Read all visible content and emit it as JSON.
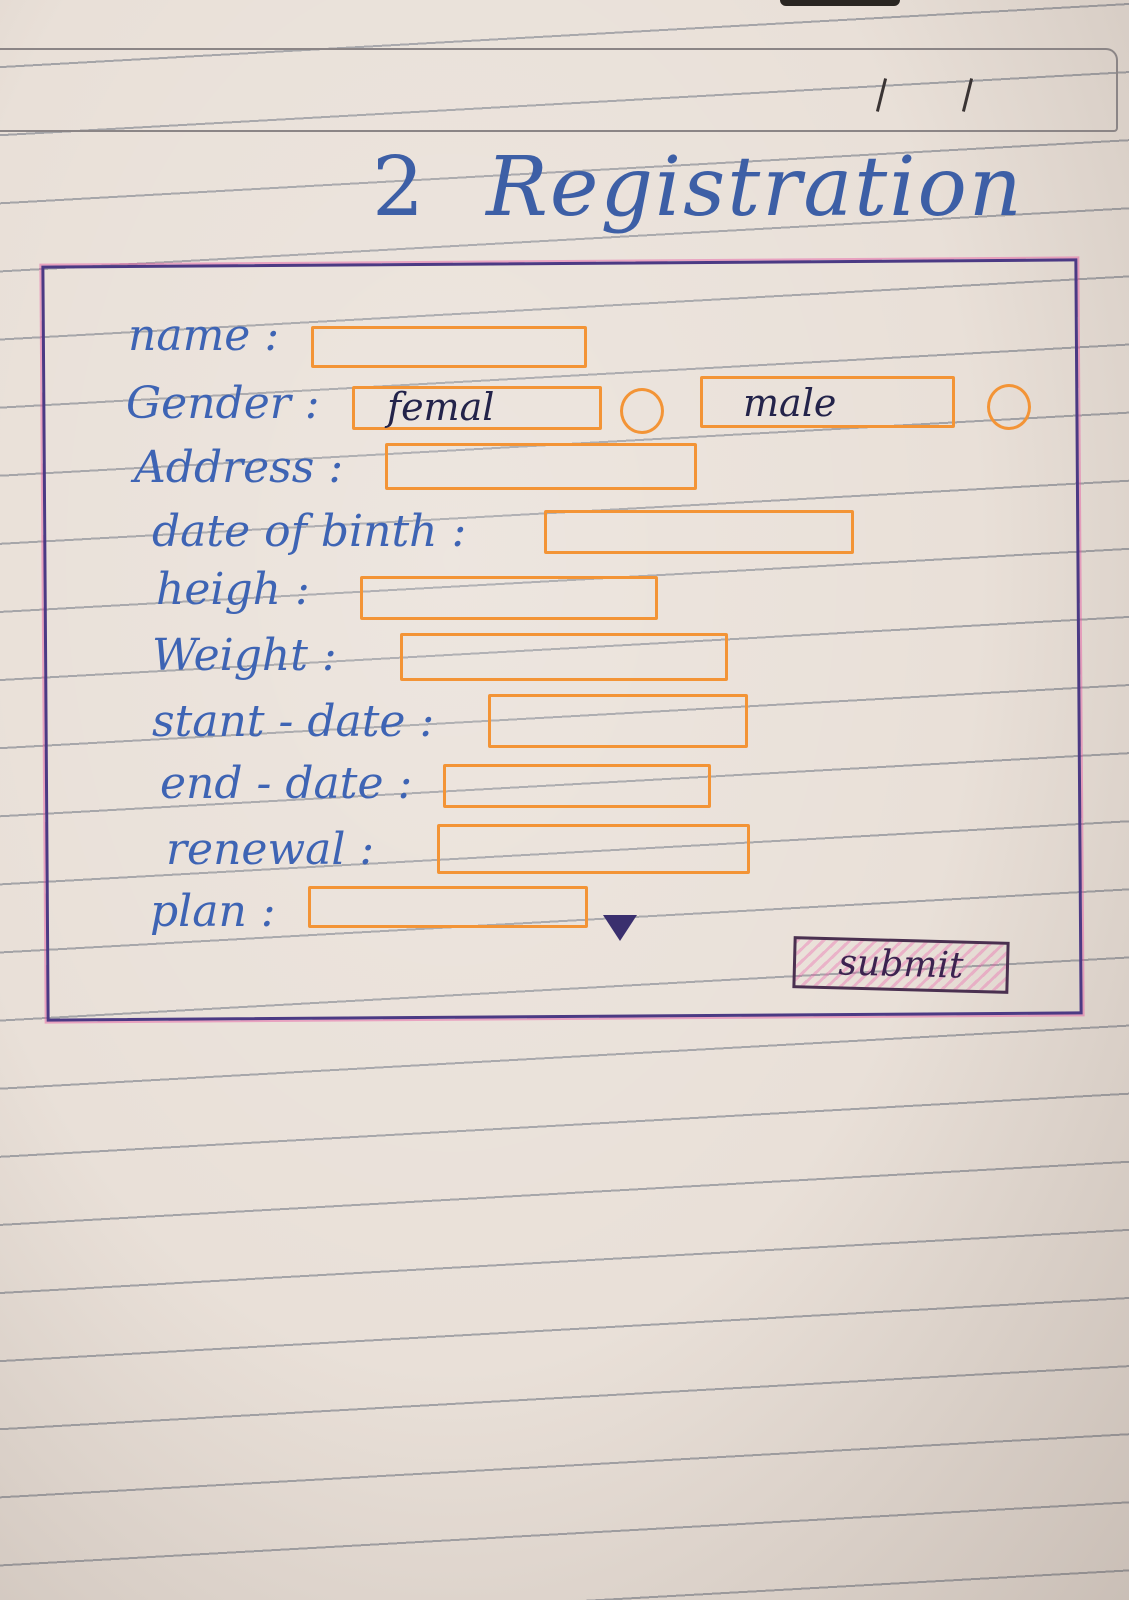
{
  "header": {
    "date_slashes": "/ /"
  },
  "title": {
    "number": "2",
    "text": "Registration"
  },
  "form": {
    "name_label": "name :",
    "gender_label": "Gender :",
    "gender_female": "femal",
    "gender_male": "male",
    "address_label": "Address :",
    "dob_label": "date of binth :",
    "height_label": "heigh :",
    "weight_label": "Weight :",
    "start_date_label": "stant - date :",
    "end_date_label": "end - date :",
    "renewal_label": "renewal :",
    "plan_label": "plan :",
    "submit_label": "submit"
  },
  "colors": {
    "ink_blue": "#3e64b4",
    "field_orange": "#f39436",
    "frame_purple": "#4b3a84",
    "accent_pink": "#e655a0"
  }
}
